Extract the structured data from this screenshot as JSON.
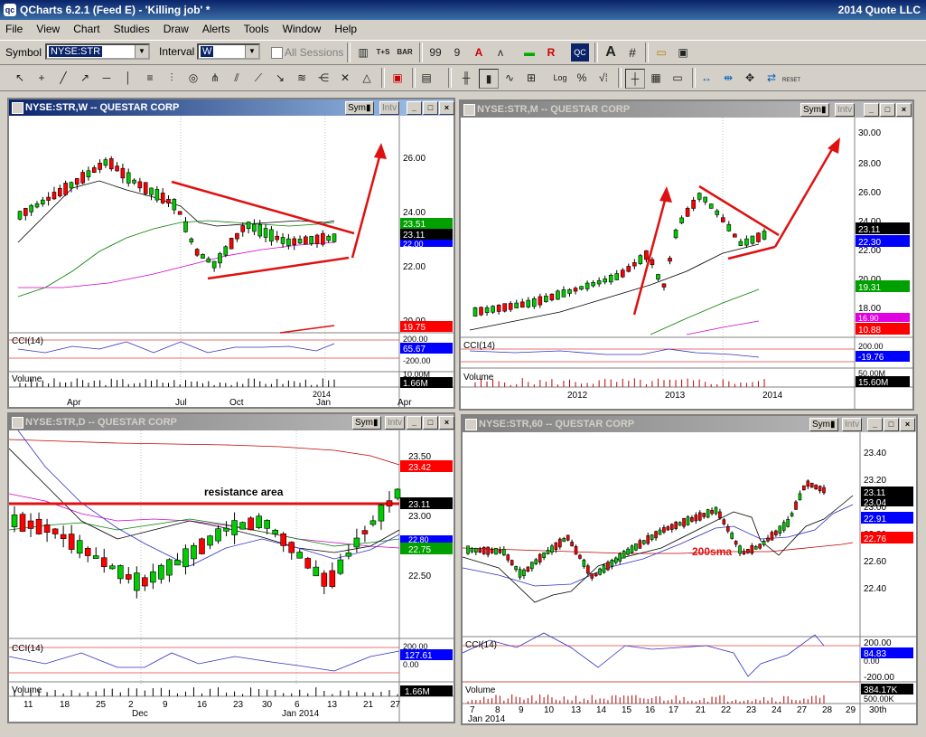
{
  "app": {
    "title": "QCharts 6.2.1 (Feed E) - 'Killing job' *",
    "right": "2014 Quote LLC",
    "icon": "qc"
  },
  "menu": [
    "File",
    "View",
    "Chart",
    "Studies",
    "Draw",
    "Alerts",
    "Tools",
    "Window",
    "Help"
  ],
  "toolbar": {
    "symbol_label": "Symbol",
    "symbol_value": "NYSE:STR",
    "interval_label": "Interval",
    "interval_value": "W",
    "all_sessions": "All Sessions",
    "ts_label": "T+S",
    "bar_label": "BAR",
    "reset_label": "RESET"
  },
  "charts": [
    {
      "title": "NYSE:STR,W -- QUESTAR CORP",
      "active": true,
      "prices": [
        "26.00",
        "24.00",
        "22.00",
        "20.00"
      ],
      "badges": [
        "23.51",
        "23.11",
        "22.00",
        "19.75"
      ],
      "cci_label": "CCI(14)",
      "cci_ticks": [
        "200.00",
        "-200.00"
      ],
      "cci_badge": "65.67",
      "volume_label": "Volume",
      "volume_badge": "1.66M",
      "volume_hidden_top": "10.00M",
      "x_year": "2014",
      "x_labels": [
        "Apr",
        "Jul",
        "Oct",
        "Jan",
        "Apr"
      ]
    },
    {
      "title": "NYSE:STR,M -- QUESTAR CORP",
      "active": false,
      "prices": [
        "30.00",
        "28.00",
        "26.00",
        "24.00",
        "22.00",
        "20.00",
        "18.00"
      ],
      "badges": [
        "23.11",
        "22.30",
        "19.31",
        "16.90",
        "10.88"
      ],
      "cci_label": "CCI(14)",
      "cci_ticks": [
        "200.00"
      ],
      "cci_badge": "-19.76",
      "volume_label": "Volume",
      "volume_badge": "15.60M",
      "volume_hidden_top": "50.00M",
      "x_labels": [
        "2012",
        "2013",
        "2014"
      ]
    },
    {
      "title": "NYSE:STR,D -- QUESTAR CORP",
      "active": false,
      "prices": [
        "23.50",
        "23.00",
        "22.50"
      ],
      "badges": [
        "23.42",
        "23.11",
        "22.80",
        "22.75"
      ],
      "annotation": "resistance area",
      "cci_label": "CCI(14)",
      "cci_ticks": [
        "200.00",
        "0.00"
      ],
      "cci_badge": "127.61",
      "volume_label": "Volume",
      "volume_badge": "1.66M",
      "x_labels": [
        "11",
        "18",
        "25",
        "2",
        "9",
        "16",
        "23",
        "30",
        "6",
        "13",
        "21",
        "27"
      ],
      "x_months": [
        "Dec",
        "Jan 2014"
      ]
    },
    {
      "title": "NYSE:STR,60 -- QUESTAR CORP",
      "active": false,
      "prices": [
        "23.40",
        "23.20",
        "23.00",
        "22.80",
        "22.60",
        "22.40"
      ],
      "badges": [
        "23.11",
        "23.04",
        "22.91",
        "22.76"
      ],
      "annotation": "200sma",
      "cci_label": "CCI(14)",
      "cci_ticks": [
        "200.00",
        "0.00",
        "-200.00"
      ],
      "cci_badge": "84.83",
      "volume_label": "Volume",
      "volume_badge": "384.17K",
      "volume_hidden_top": "500.00K",
      "x_labels": [
        "7",
        "8",
        "9",
        "10",
        "13",
        "14",
        "15",
        "16",
        "17",
        "21",
        "22",
        "23",
        "24",
        "27",
        "28",
        "29",
        "30th"
      ],
      "x_months": [
        "Jan 2014"
      ]
    }
  ],
  "colors": {
    "up_candle": "#00cc00",
    "down_candle": "#ff0000",
    "annotation_red": "#e01010",
    "cci_line": "#3030c0",
    "badge_green": "#00a000",
    "badge_black": "#000000",
    "badge_blue": "#0000ff",
    "badge_red": "#ff0000"
  }
}
